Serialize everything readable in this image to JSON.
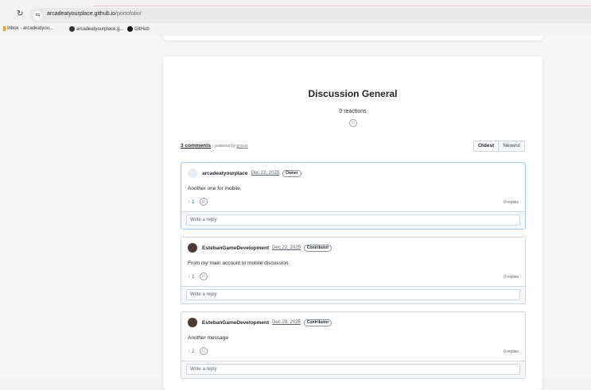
{
  "browser": {
    "reload_icon": "reload-icon",
    "url_host": "arcadeatyourplace.github.io",
    "url_path": "/portofolio/",
    "bookmarks": [
      {
        "label": "Inbox - arcadeatyou...",
        "icon": "mail-icon"
      },
      {
        "label": "arcadeatyourplace.g...",
        "icon": "github-icon"
      },
      {
        "label": "GitHub",
        "icon": "github-icon"
      }
    ]
  },
  "discussion": {
    "title": "Discussion General",
    "reactions_label": "0 reactions",
    "comments_link": "3 comments",
    "powered_prefix": "– powered by",
    "powered_name": "giscus",
    "sort_oldest": "Oldest",
    "sort_newest": "Newest"
  },
  "comments": [
    {
      "author": "arcadeatyourplace",
      "date": "Dec 22, 2025",
      "badge": "Owner",
      "body": "Another one for mobile.",
      "upvotes": "↑ 1",
      "replies": "0 replies",
      "reply_placeholder": "Write a reply"
    },
    {
      "author": "EstebanGameDevelopment",
      "date": "Dec 22, 2025",
      "badge": "Contributor",
      "body": "From my main account to mobile discussion.",
      "upvotes": "↑ 1",
      "replies": "0 replies",
      "reply_placeholder": "Write a reply"
    },
    {
      "author": "EstebanGameDevelopment",
      "date": "Dec 29, 2025",
      "badge": "Contributor",
      "body": "Another message",
      "upvotes": "↑ 1",
      "replies": "0 replies",
      "reply_placeholder": "Write a reply"
    }
  ],
  "colors": {
    "accent": "#0969da",
    "border": "#d0d7de"
  }
}
